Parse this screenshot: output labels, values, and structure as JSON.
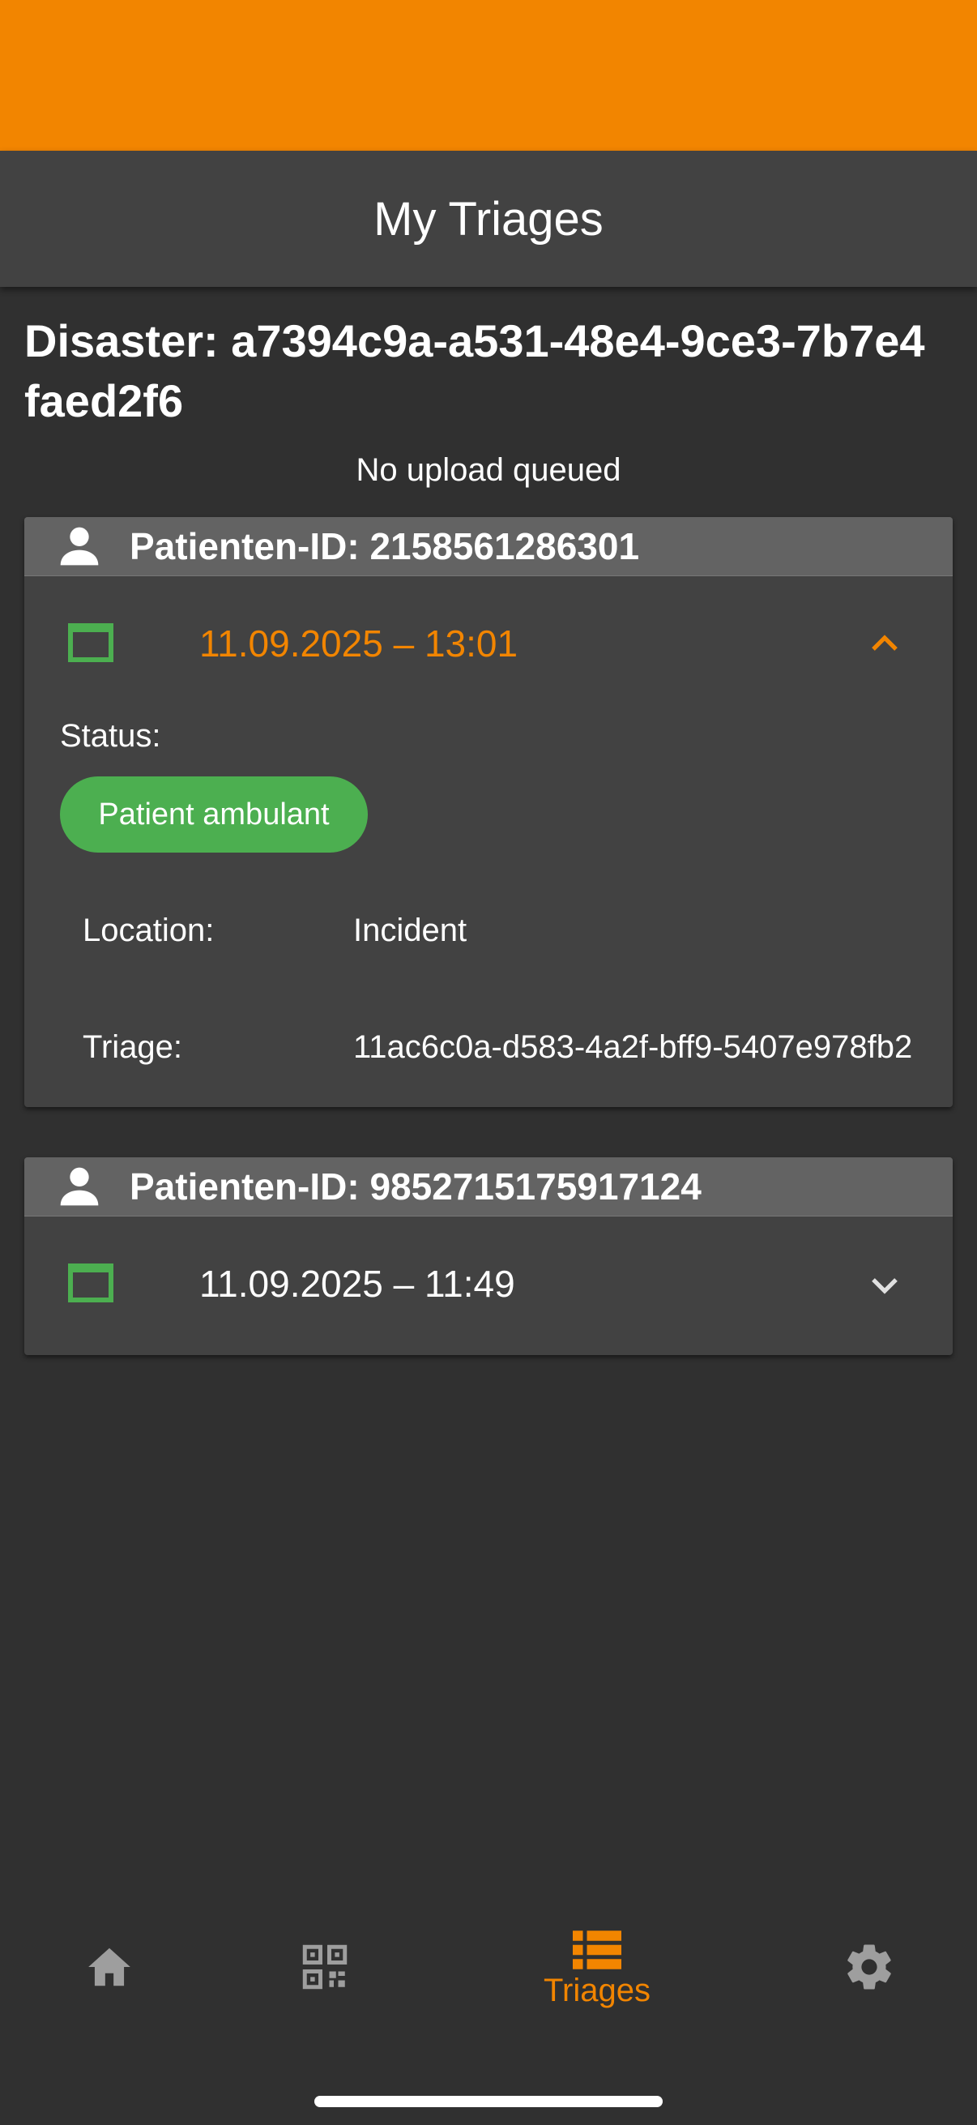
{
  "app_bar": {
    "title": "My Triages"
  },
  "disaster": {
    "title": "Disaster: a7394c9a-a531-48e4-9ce3-7b7e4faed2f6"
  },
  "upload_status": "No upload queued",
  "colors": {
    "accent": "#f28500",
    "status_green": "#4caf50",
    "card_green": "#4caf50"
  },
  "patients": [
    {
      "id_label": "Patienten-ID: 2158561286301",
      "date": "11.09.2025 – 13:01",
      "expanded": true,
      "status_label": "Status:",
      "status_value": "Patient ambulant",
      "location_label": "Location:",
      "location_value": "Incident",
      "triage_label": "Triage:",
      "triage_value": "11ac6c0a-d583-4a2f-bff9-5407e978fb2"
    },
    {
      "id_label": "Patienten-ID: 9852715175917124",
      "date": "11.09.2025 – 11:49",
      "expanded": false
    }
  ],
  "bottom_nav": {
    "items": [
      {
        "icon": "home-icon"
      },
      {
        "icon": "qr-code-icon"
      },
      {
        "icon": "list-icon",
        "label": "Triages",
        "active": true
      },
      {
        "icon": "gear-icon"
      }
    ]
  }
}
